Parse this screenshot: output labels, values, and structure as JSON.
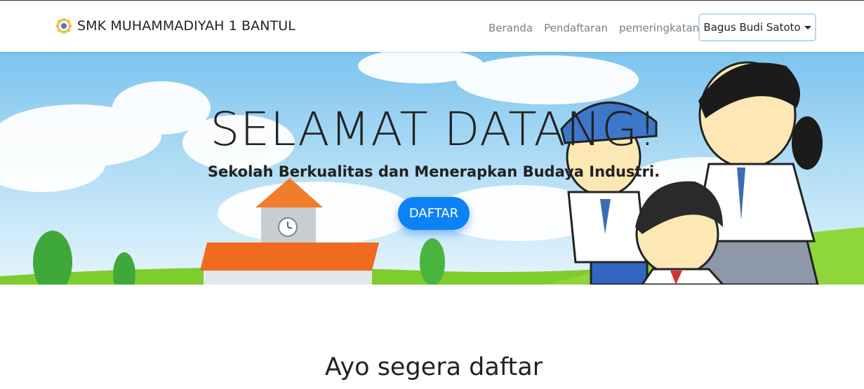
{
  "navbar": {
    "brand": "SMK MUHAMMADIYAH 1 BANTUL",
    "links": [
      "Beranda",
      "Pendaftaran",
      "pemeringkatan"
    ],
    "user_menu": "Bagus Budi Satoto"
  },
  "hero": {
    "title": "SELAMAT DATANG!",
    "subtitle": "Sekolah Berkualitas dan Menerapkan Budaya Industri.",
    "cta": "DAFTAR"
  },
  "section": {
    "title": "Ayo segera daftar"
  },
  "colors": {
    "primary": "#0d82f5",
    "nav_link": "#7b7f84",
    "user_btn_border": "#bcd8f2"
  }
}
